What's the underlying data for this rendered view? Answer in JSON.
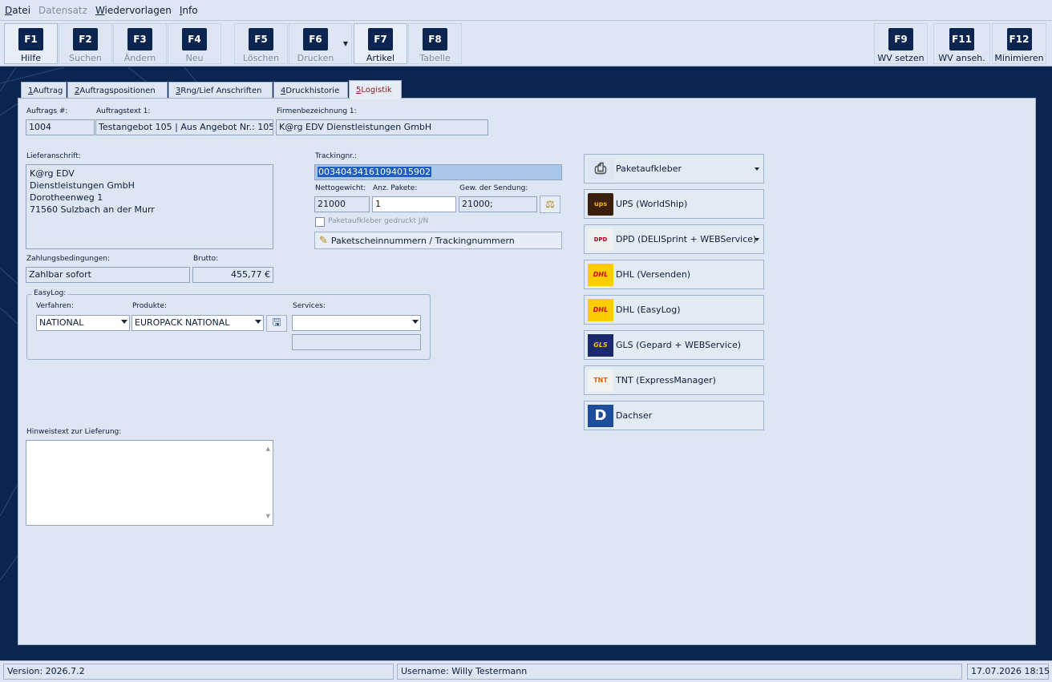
{
  "menu": {
    "items": [
      {
        "label": "Datei",
        "underline": "D",
        "enabled": true
      },
      {
        "label": "Datensatz",
        "enabled": false
      },
      {
        "label": "Wiedervorlagen",
        "underline": "W",
        "enabled": true
      },
      {
        "label": "Info",
        "underline": "I",
        "enabled": true
      }
    ]
  },
  "toolbar": {
    "f1": {
      "key": "F1",
      "label": "Hilfe"
    },
    "f2": {
      "key": "F2",
      "label": "Suchen"
    },
    "f3": {
      "key": "F3",
      "label": "Ändern"
    },
    "f4": {
      "key": "F4",
      "label": "Neu"
    },
    "f5": {
      "key": "F5",
      "label": "Löschen"
    },
    "f6": {
      "key": "F6",
      "label": "Drucken"
    },
    "f7": {
      "key": "F7",
      "label": "Artikel"
    },
    "f8": {
      "key": "F8",
      "label": "Tabelle"
    },
    "f9": {
      "key": "F9",
      "label": "WV setzen"
    },
    "f11": {
      "key": "F11",
      "label": "WV anseh."
    },
    "f12": {
      "key": "F12",
      "label": "Minimieren"
    }
  },
  "tabs": {
    "t1": {
      "num": "1",
      "label": " Auftrag"
    },
    "t2": {
      "num": "2",
      "label": " Auftragspositionen"
    },
    "t3": {
      "num": "3",
      "label": " Rng/Lief Anschriften"
    },
    "t4": {
      "num": "4",
      "label": " Druckhistorie"
    },
    "t5": {
      "num": "5",
      "label": " Logistik"
    }
  },
  "form": {
    "auftrags_nr": {
      "label": "Auftrags #:",
      "value": "1004"
    },
    "auftragstext": {
      "label": "Auftragstext 1:",
      "value": "Testangebot 105 | Aus Angebot Nr.: 105"
    },
    "firmenbezeichnung": {
      "label": "Firmenbezeichnung 1:",
      "value": "K@rg EDV Dienstleistungen GmbH"
    },
    "lieferanschrift": {
      "label": "Lieferanschrift:",
      "lines": [
        "K@rg EDV",
        "Dienstleistungen GmbH",
        "Dorotheenweg 1",
        "71560 Sulzbach an der Murr"
      ]
    },
    "zahlungsbedingungen": {
      "label": "Zahlungsbedingungen:",
      "value": "Zahlbar sofort"
    },
    "brutto": {
      "label": "Brutto:",
      "value": "455,77 €"
    },
    "trackingnr": {
      "label": "Trackingnr.:",
      "value": "00340434161094015902"
    },
    "nettogewicht": {
      "label": "Nettogewicht:",
      "value": "21000"
    },
    "anz_pakete": {
      "label": "Anz. Pakete:",
      "value": "1"
    },
    "gew_sendung": {
      "label": "Gew. der Sendung:",
      "value": "21000;"
    },
    "paketaufkleber_checkbox": {
      "label": "Paketaufkleber gedruckt J/N",
      "checked": false
    },
    "paketschein_button": "Paketscheinnummern / Trackingnummern",
    "easylog": {
      "group_label": "EasyLog:",
      "verfahren": {
        "label": "Verfahren:",
        "value": "NATIONAL"
      },
      "produkte": {
        "label": "Produkte:",
        "value": "EUROPACK NATIONAL"
      },
      "services": {
        "label": "Services:",
        "value": ""
      },
      "services_extra": ""
    },
    "hinweistext": {
      "label": "Hinweistext zur Lieferung:",
      "value": ""
    }
  },
  "carriers": [
    {
      "label": "Paketaufkleber",
      "icon": "printer-icon",
      "dropdown": true
    },
    {
      "label": "UPS (WorldShip)",
      "icon": "ups-logo",
      "logo_text": "ups",
      "dropdown": false
    },
    {
      "label": "DPD (DELISprint + WEBService)",
      "icon": "dpd-logo",
      "logo_text": "DPD",
      "dropdown": true
    },
    {
      "label": "DHL (Versenden)",
      "icon": "dhl-logo",
      "logo_text": "DHL",
      "dropdown": false
    },
    {
      "label": "DHL (EasyLog)",
      "icon": "dhl-logo",
      "logo_text": "DHL",
      "dropdown": false
    },
    {
      "label": "GLS (Gepard + WEBService)",
      "icon": "gls-logo",
      "logo_text": "GLS",
      "dropdown": false
    },
    {
      "label": "TNT (ExpressManager)",
      "icon": "tnt-logo",
      "logo_text": "TNT",
      "dropdown": false
    },
    {
      "label": "Dachser",
      "icon": "dachser-logo",
      "logo_text": "D",
      "dropdown": false
    }
  ],
  "status": {
    "version": "Version: 2026.7.2",
    "username": "Username: Willy Testermann",
    "datetime": "17.07.2026 18:15"
  },
  "colors": {
    "background": "#0b2550",
    "panel": "#dde6f2",
    "selected_tab_text": "#8b1a1a",
    "selection": "#1e5fbf"
  }
}
